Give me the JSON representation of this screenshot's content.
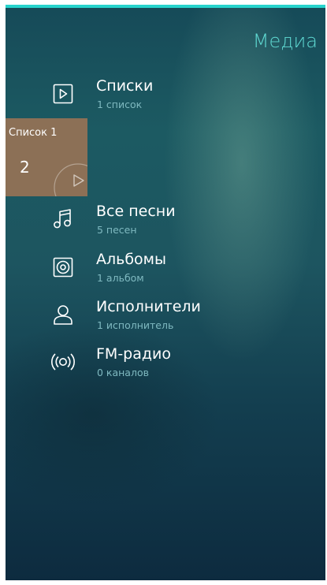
{
  "header": {
    "title": "Медиа"
  },
  "menu": {
    "items": [
      {
        "title": "Списки",
        "subtitle": "1 список",
        "icon": "play-square-icon"
      },
      {
        "title": "Все песни",
        "subtitle": "5 песен",
        "icon": "music-note-icon"
      },
      {
        "title": "Альбомы",
        "subtitle": "1 альбом",
        "icon": "album-disc-icon"
      },
      {
        "title": "Исполнители",
        "subtitle": "1 исполнитель",
        "icon": "person-icon"
      },
      {
        "title": "FM-радио",
        "subtitle": "0 каналов",
        "icon": "radio-broadcast-icon"
      }
    ]
  },
  "cover": {
    "label": "Список 1",
    "count": "2",
    "icon": "play-circle-icon"
  },
  "colors": {
    "accent": "#27d3cc",
    "title": "#5fd9d2",
    "subtitle": "#7fb9c0",
    "cover": "#8c7056"
  }
}
